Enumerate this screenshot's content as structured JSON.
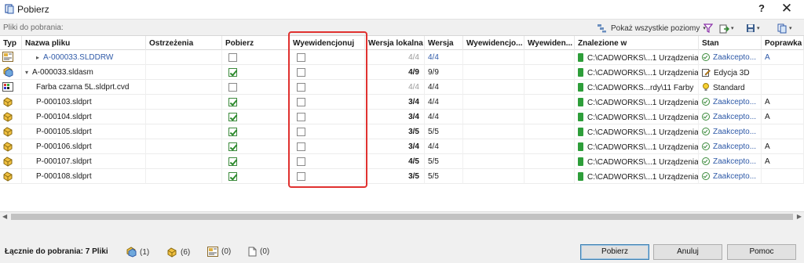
{
  "window": {
    "title": "Pobierz",
    "help_glyph": "?",
    "close_glyph": "✕"
  },
  "toolbar": {
    "section_label": "Pliki do pobrania:",
    "show_all_levels": "Pokaż wszystkie poziomy",
    "chevron": "▾"
  },
  "columns": [
    "Typ",
    "Nazwa pliku",
    "Ostrzeżenia",
    "Pobierz",
    "Wyewidencjonuj",
    "Wersja lokalna",
    "Wersja",
    "Wyewidencjo...",
    "Wyewiden...",
    "Znalezione w",
    "Stan",
    "Poprawka"
  ],
  "rows": [
    {
      "type_icon": "drawing-icon",
      "name": "A-000033.SLDDRW",
      "tree": "▸",
      "indent": 2,
      "warnings": "",
      "get": false,
      "checkout": false,
      "local_version": "4/4",
      "local_bold": false,
      "version": "4/4",
      "found_in": "C:\\CADWORKS\\...1 Urządzenia",
      "state": "Zaakcepto...",
      "state_icon": "approved-icon",
      "revision": "A",
      "name_blue": true,
      "version_blue": true
    },
    {
      "type_icon": "assembly-icon",
      "name": "A-000033.sldasm",
      "tree": "▾",
      "indent": 1,
      "warnings": "",
      "get": true,
      "checkout": false,
      "local_version": "4/9",
      "local_bold": true,
      "version": "9/9",
      "found_in": "C:\\CADWORKS\\...1 Urządzenia",
      "state": "Edycja 3D",
      "state_icon": "edit-icon",
      "revision": "",
      "name_blue": false,
      "version_blue": false
    },
    {
      "type_icon": "appearance-icon",
      "name": "Farba czarna 5L.sldprt.cvd",
      "tree": "",
      "indent": 2,
      "warnings": "",
      "get": false,
      "checkout": false,
      "local_version": "4/4",
      "local_bold": false,
      "version": "4/4",
      "found_in": "C:\\CADWORKS...rdy\\11 Farby",
      "state": "Standard",
      "state_icon": "lightbulb-icon",
      "revision": "",
      "name_blue": false,
      "version_blue": false
    },
    {
      "type_icon": "part-icon",
      "name": "P-000103.sldprt",
      "tree": "",
      "indent": 2,
      "warnings": "",
      "get": true,
      "checkout": false,
      "local_version": "3/4",
      "local_bold": true,
      "version": "4/4",
      "found_in": "C:\\CADWORKS\\...1 Urządzenia",
      "state": "Zaakcepto...",
      "state_icon": "approved-icon",
      "revision": "A",
      "name_blue": false,
      "version_blue": false
    },
    {
      "type_icon": "part-icon",
      "name": "P-000104.sldprt",
      "tree": "",
      "indent": 2,
      "warnings": "",
      "get": true,
      "checkout": false,
      "local_version": "3/4",
      "local_bold": true,
      "version": "4/4",
      "found_in": "C:\\CADWORKS\\...1 Urządzenia",
      "state": "Zaakcepto...",
      "state_icon": "approved-icon",
      "revision": "A",
      "name_blue": false,
      "version_blue": false
    },
    {
      "type_icon": "part-icon",
      "name": "P-000105.sldprt",
      "tree": "",
      "indent": 2,
      "warnings": "",
      "get": true,
      "checkout": false,
      "local_version": "3/5",
      "local_bold": true,
      "version": "5/5",
      "found_in": "C:\\CADWORKS\\...1 Urządzenia",
      "state": "Zaakcepto...",
      "state_icon": "approved-icon",
      "revision": "",
      "name_blue": false,
      "version_blue": false
    },
    {
      "type_icon": "part-icon",
      "name": "P-000106.sldprt",
      "tree": "",
      "indent": 2,
      "warnings": "",
      "get": true,
      "checkout": false,
      "local_version": "3/4",
      "local_bold": true,
      "version": "4/4",
      "found_in": "C:\\CADWORKS\\...1 Urządzenia",
      "state": "Zaakcepto...",
      "state_icon": "approved-icon",
      "revision": "A",
      "name_blue": false,
      "version_blue": false
    },
    {
      "type_icon": "part-icon",
      "name": "P-000107.sldprt",
      "tree": "",
      "indent": 2,
      "warnings": "",
      "get": true,
      "checkout": false,
      "local_version": "4/5",
      "local_bold": true,
      "version": "5/5",
      "found_in": "C:\\CADWORKS\\...1 Urządzenia",
      "state": "Zaakcepto...",
      "state_icon": "approved-icon",
      "revision": "A",
      "name_blue": false,
      "version_blue": false
    },
    {
      "type_icon": "part-icon",
      "name": "P-000108.sldprt",
      "tree": "",
      "indent": 2,
      "warnings": "",
      "get": true,
      "checkout": false,
      "local_version": "3/5",
      "local_bold": true,
      "version": "5/5",
      "found_in": "C:\\CADWORKS\\...1 Urządzenia",
      "state": "Zaakcepto...",
      "state_icon": "approved-icon",
      "revision": "",
      "name_blue": false,
      "version_blue": false
    }
  ],
  "footer": {
    "total_label": "Łącznie do pobrania:  7 Pliki",
    "stats": [
      {
        "icon": "assembly-icon",
        "value": "(1)"
      },
      {
        "icon": "part-icon",
        "value": "(6)"
      },
      {
        "icon": "drawing-icon",
        "value": "(0)"
      },
      {
        "icon": "document-icon",
        "value": "(0)"
      }
    ],
    "buttons": {
      "get": "Pobierz",
      "cancel": "Anuluj",
      "help": "Pomoc"
    }
  },
  "colors": {
    "accent_blue": "#2f5aa8",
    "highlight_red": "#e0312f",
    "check_green": "#2e8b2e"
  }
}
